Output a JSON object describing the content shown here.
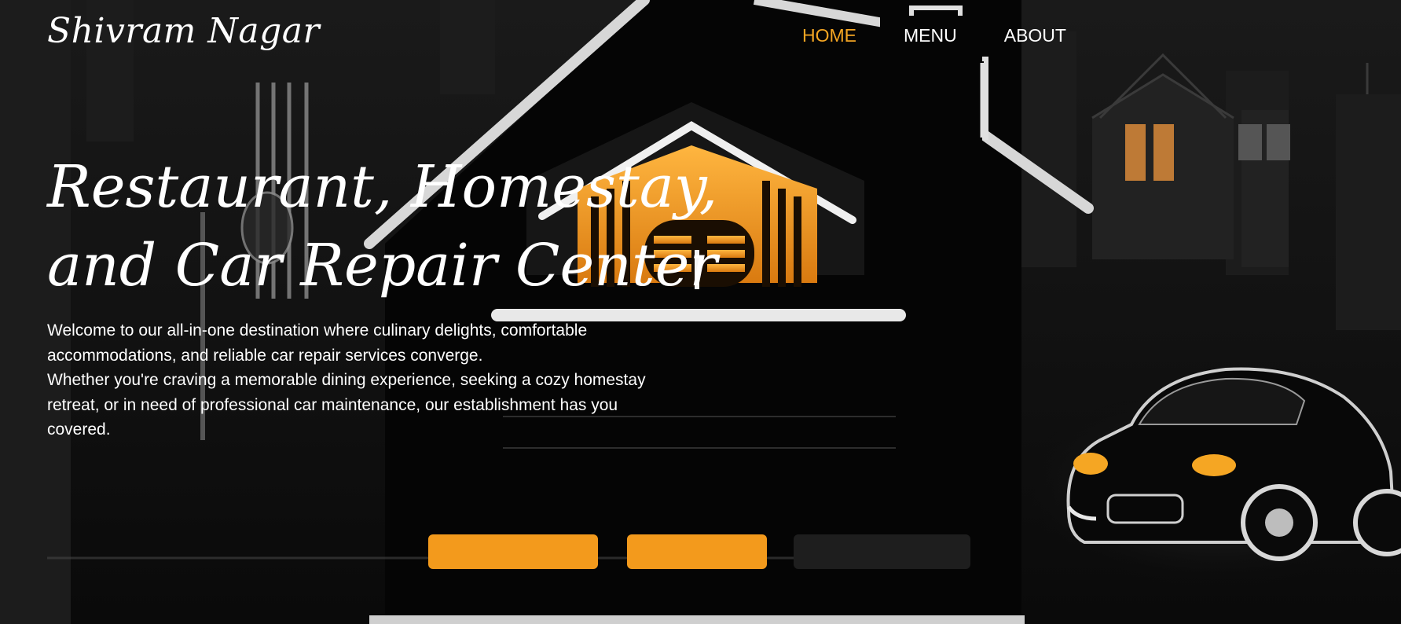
{
  "brand": {
    "name": "Shivram Nagar"
  },
  "nav": {
    "items": [
      {
        "label": "HOME",
        "active": true
      },
      {
        "label": "MENU",
        "active": false
      },
      {
        "label": "ABOUT",
        "active": false
      }
    ]
  },
  "hero": {
    "title": "Restaurant, Homestay, and Car Repair Center",
    "paragraph_1": "Welcome to our all-in-one destination where culinary delights, comfortable accommodations, and reliable car repair services converge.",
    "paragraph_2": "Whether you're craving a memorable dining experience, seeking a cozy homestay retreat, or in need of professional car maintenance, our establishment has you covered."
  },
  "colors": {
    "accent": "#f5a623",
    "background": "#0b0b0b",
    "text": "#ffffff"
  }
}
